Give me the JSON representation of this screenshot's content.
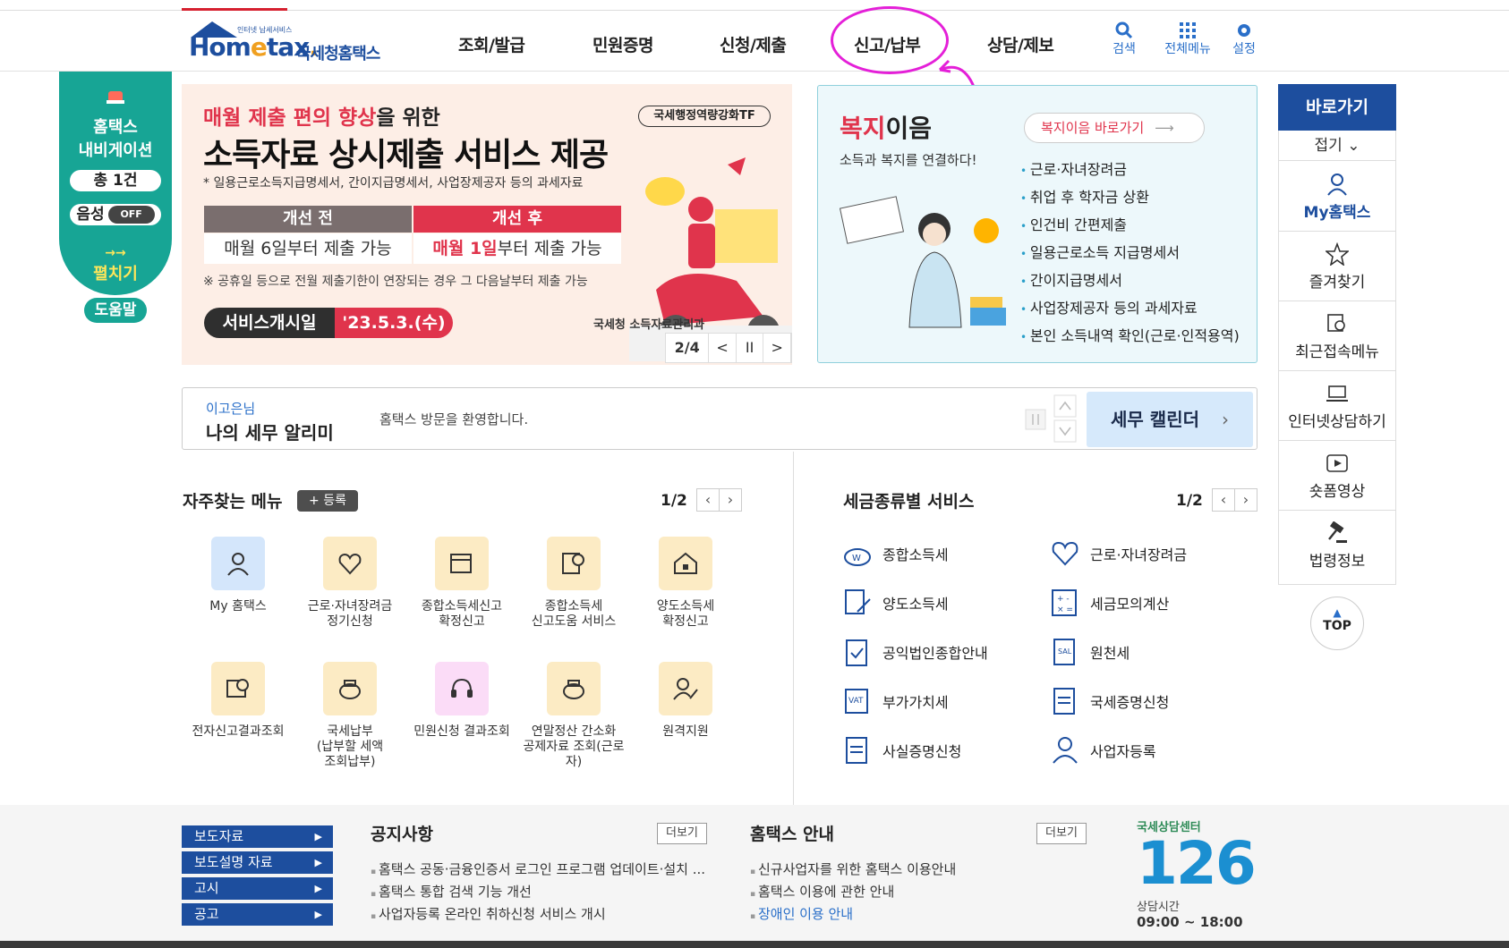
{
  "header": {
    "logo_tag": "인터넷 납세서비스",
    "logo_home": "Hom",
    "logo_e": "e",
    "logo_tax": "tax",
    "logo_dot": ".",
    "logo_kr": "국세청홈택스",
    "nav": [
      "조회/발급",
      "민원증명",
      "신청/제출",
      "신고/납부",
      "상담/제보"
    ],
    "tools": [
      {
        "label": "검색",
        "icon": "search-icon"
      },
      {
        "label": "전체메뉴",
        "icon": "grid-menu-icon"
      },
      {
        "label": "설정",
        "icon": "gear-icon"
      }
    ]
  },
  "navigator": {
    "title1": "홈택스",
    "title2": "내비게이션",
    "count": "총 1건",
    "voice": "음성",
    "toggle": "OFF",
    "open_arrow": "→→",
    "open": "펼치기",
    "help": "도움말"
  },
  "banner": {
    "sub_hl": "매월 제출 편의 향상",
    "sub_rest": "을 위한",
    "tf": "국세행정역량강화TF",
    "title": "소득자료 상시제출 서비스 제공",
    "note1": "* 일용근로소득지급명세서, 간이지급명세서, 사업장제공자 등의 과세자료",
    "before_h": "개선 전",
    "after_h": "개선 후",
    "before_c": "매월 6일부터 제출 가능",
    "after_c_hl": "매월 1일",
    "after_c_rest": "부터 제출 가능",
    "note2": "※ 공휴일 등으로 전월 제출기한이 연장되는 경우 그 다음날부터 제출 가능",
    "svc_label": "서비스개시일",
    "svc_date": "'23.5.3.(수)",
    "org": "국세청  소득자료관리과",
    "page": "2/4",
    "prev": "<",
    "pause": "II",
    "next": ">"
  },
  "welfare": {
    "title_hl": "복지",
    "title_rest": "이음",
    "sub": "소득과 복지를 연결하다!",
    "go": "복지이음 바로가기",
    "items": [
      "근로·자녀장려금",
      "취업 후 학자금 상환",
      "인건비 간편제출",
      "일용근로소득 지급명세서",
      "간이지급명세서",
      "사업장제공자 등의 과세자료",
      "본인 소득내역 확인(근로·인적용역)"
    ]
  },
  "quick": {
    "header": "바로가기",
    "fold": "접기",
    "items": [
      "My홈택스",
      "즐겨찾기",
      "최근접속메뉴",
      "인터넷상담하기",
      "숏폼영상",
      "법령정보"
    ],
    "top": "TOP"
  },
  "alert": {
    "name": "이고은님",
    "label": "나의 세무 알리미",
    "message": "홈택스 방문을 환영합니다.",
    "calendar": "세무 캘린더"
  },
  "frequent": {
    "title": "자주찾는 메뉴",
    "register": "+ 등록",
    "page": "1/2",
    "items": [
      {
        "l1": "My 홈택스",
        "l2": "",
        "l3": ""
      },
      {
        "l1": "근로·자녀장려금",
        "l2": "정기신청",
        "l3": ""
      },
      {
        "l1": "종합소득세신고",
        "l2": "확정신고",
        "l3": ""
      },
      {
        "l1": "종합소득세",
        "l2": "신고도움 서비스",
        "l3": ""
      },
      {
        "l1": "양도소득세",
        "l2": "확정신고",
        "l3": ""
      },
      {
        "l1": "전자신고결과조회",
        "l2": "",
        "l3": ""
      },
      {
        "l1": "국세납부",
        "l2": "(납부할 세액",
        "l3": "조회납부)"
      },
      {
        "l1": "민원신청 결과조회",
        "l2": "",
        "l3": ""
      },
      {
        "l1": "연말정산 간소화",
        "l2": "공제자료 조회(근로",
        "l3": "자)"
      },
      {
        "l1": "원격지원",
        "l2": "",
        "l3": ""
      }
    ]
  },
  "taxsvc": {
    "title": "세금종류별 서비스",
    "page": "1/2",
    "items": [
      "종합소득세",
      "근로·자녀장려금",
      "양도소득세",
      "세금모의계산",
      "공익법인종합안내",
      "원천세",
      "부가가치세",
      "국세증명신청",
      "사실증명신청",
      "사업자등록"
    ]
  },
  "footer": {
    "buttons": [
      "보도자료",
      "보도설명 자료",
      "고시",
      "공고"
    ],
    "notice_title": "공지사항",
    "notice_more": "더보기",
    "notices": [
      "홈택스 공동·금융인증서 로그인 프로그램 업데이트·설치 ...",
      "홈택스 통합 검색 기능 개선",
      "사업자등록 온라인 취하신청 서비스 개시"
    ],
    "guide_title": "홈택스 안내",
    "guide_more": "더보기",
    "guides": [
      "신규사업자를 위한 홈택스 이용안내",
      "홈택스 이용에 관한 안내",
      "장애인 이용 안내"
    ],
    "center_title": "국세상담센터",
    "center_num": "126",
    "center_hours_label": "상담시간",
    "center_hours": "09:00 ~ 18:00"
  },
  "colors": {
    "brand_blue": "#1d4e9e",
    "navigator_teal": "#17a595",
    "accent_red": "#e0344c",
    "annotation_magenta": "#e41fd8"
  }
}
